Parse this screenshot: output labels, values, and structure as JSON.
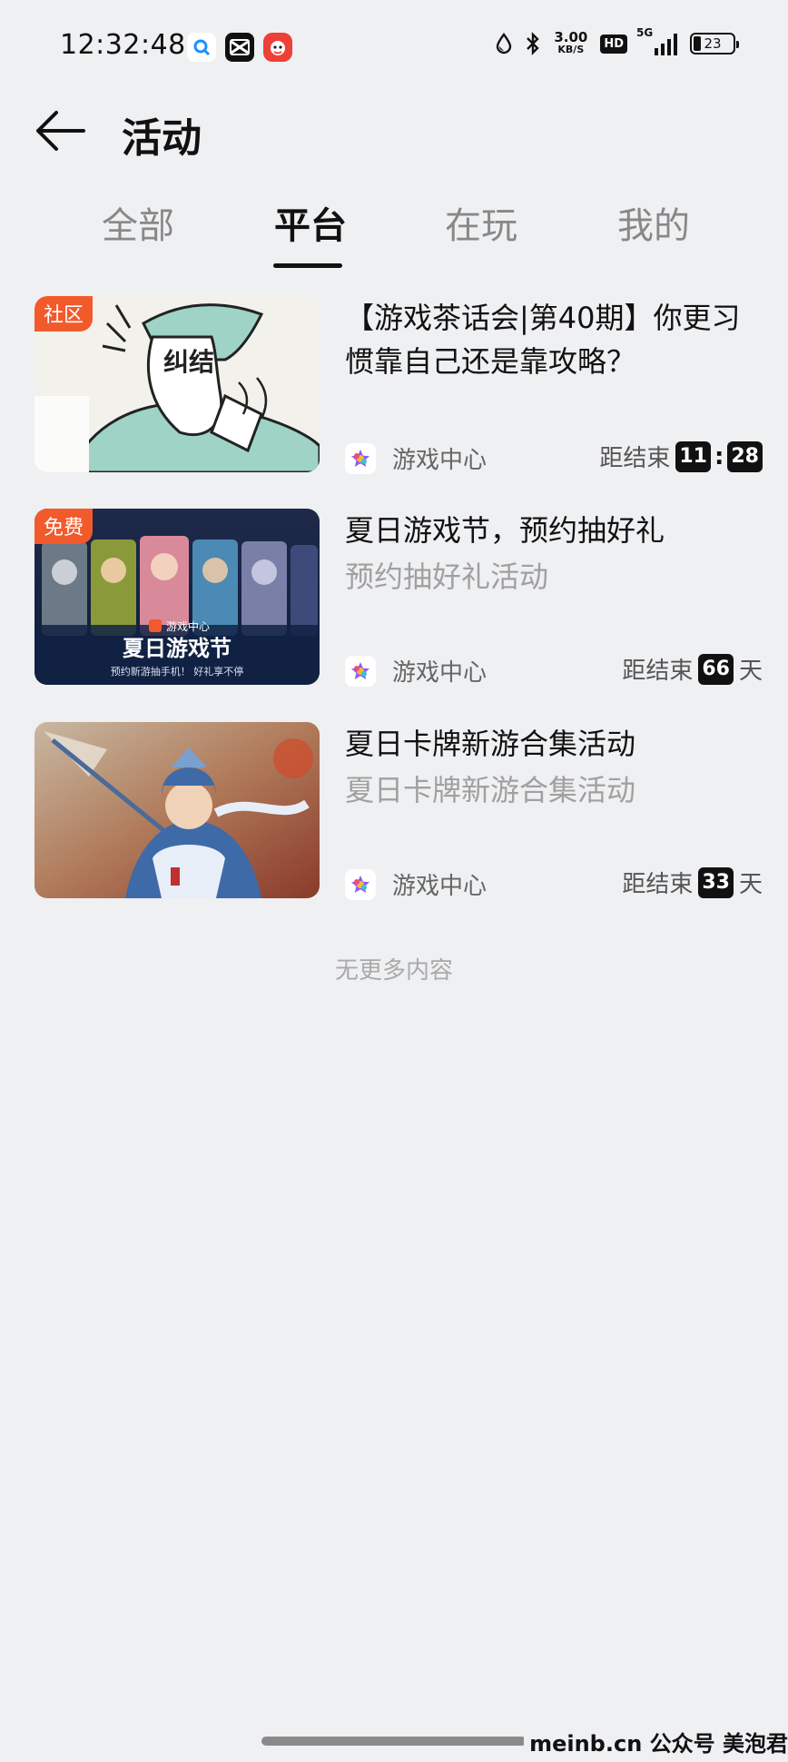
{
  "status_bar": {
    "time": "12:32:48",
    "speed_value": "3.00",
    "speed_unit": "KB/S",
    "hd": "HD",
    "network": "5G",
    "battery": "23"
  },
  "header": {
    "title": "活动"
  },
  "tabs": [
    {
      "label": "全部",
      "active": false
    },
    {
      "label": "平台",
      "active": true
    },
    {
      "label": "在玩",
      "active": false
    },
    {
      "label": "我的",
      "active": false
    }
  ],
  "activities": [
    {
      "badge": "社区",
      "thumb_text": "纠结",
      "title": "【游戏茶话会|第40期】你更习惯靠自己还是靠攻略？",
      "subtitle": "",
      "source": "游戏中心",
      "deadline_label": "距结束",
      "deadline_h": "11",
      "deadline_sep": ":",
      "deadline_m": "28"
    },
    {
      "badge": "免费",
      "thumb_logo": "游戏中心",
      "thumb_title": "夏日游戏节",
      "thumb_caption": "预约新游抽手机！ 好礼享不停",
      "title": "夏日游戏节，预约抽好礼",
      "subtitle": "预约抽好礼活动",
      "source": "游戏中心",
      "deadline_label": "距结束",
      "deadline_days": "66",
      "deadline_unit": "天"
    },
    {
      "badge": "",
      "title": "夏日卡牌新游合集活动",
      "subtitle": "夏日卡牌新游合集活动",
      "source": "游戏中心",
      "deadline_label": "距结束",
      "deadline_days": "33",
      "deadline_unit": "天"
    }
  ],
  "no_more": "无更多内容",
  "watermark": "meinb.cn  公众号 美泡君",
  "colors": {
    "background": "#eff0f2",
    "badge": "#f25a2c",
    "text": "#111111",
    "muted": "#a0a0a0"
  }
}
